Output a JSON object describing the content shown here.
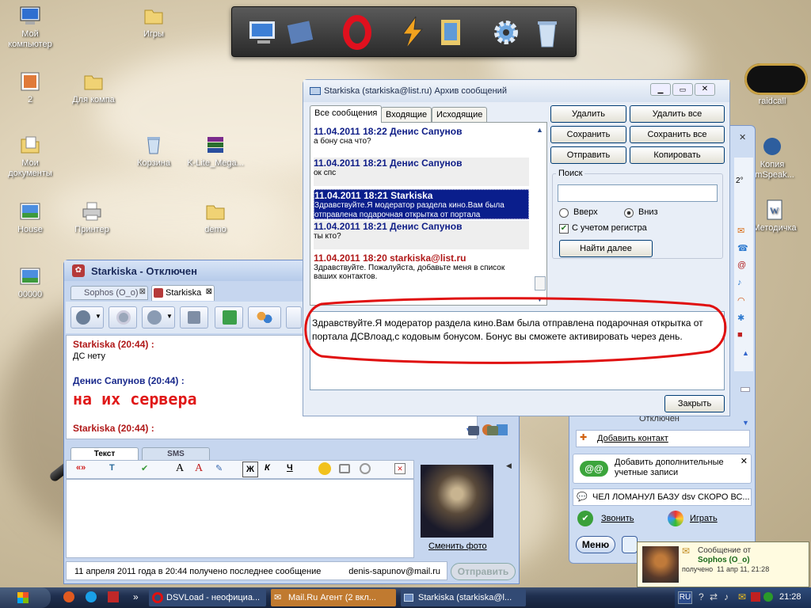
{
  "desktop": {
    "icons": [
      {
        "label": "Мой компьютер",
        "icon": "computer-icon"
      },
      {
        "label": "Игры",
        "icon": "folder-icon"
      },
      {
        "label": "2",
        "icon": "image-file-icon"
      },
      {
        "label": "Для компа",
        "icon": "folder-icon"
      },
      {
        "label": "Мои документы",
        "icon": "documents-folder-icon"
      },
      {
        "label": "Корзина",
        "icon": "recycle-bin-icon"
      },
      {
        "label": "K-Lite_Mega...",
        "icon": "archive-icon"
      },
      {
        "label": "House",
        "icon": "image-file-icon"
      },
      {
        "label": "Принтер",
        "icon": "printer-icon"
      },
      {
        "label": "demo",
        "icon": "folder-icon"
      },
      {
        "label": "00000",
        "icon": "image-file-icon"
      },
      {
        "label": "raidcall",
        "icon": "app-icon"
      },
      {
        "label": "Копия amSpeak...",
        "icon": "app-icon"
      },
      {
        "label": "Методичка",
        "icon": "word-document-icon"
      }
    ]
  },
  "chat": {
    "title": "Starkiska - Отключен",
    "tabs": [
      "Sophos (O_o)",
      "Starkiska"
    ],
    "messages": [
      {
        "header": "Starkiska (20:44) :",
        "text": "ДС нету"
      },
      {
        "header": "Денис Сапунов (20:44) :",
        "text": "на их сервера"
      },
      {
        "header": "Starkiska (20:44) :",
        "text": ""
      }
    ],
    "compose_tabs": [
      "Текст",
      "SMS"
    ],
    "change_photo": "Сменить фото",
    "status": "11 апреля 2011 года в 20:44 получено последнее сообщение",
    "email": "denis-sapunov@mail.ru",
    "send": "Отправить"
  },
  "archive": {
    "title": "Starkiska (starkiska@list.ru) Архив сообщений",
    "tabs": [
      "Все сообщения",
      "Входящие",
      "Исходящие"
    ],
    "messages": [
      {
        "header": "11.04.2011 18:22 Денис Сапунов",
        "text": "а бону сна что?"
      },
      {
        "header": "11.04.2011 18:21 Денис Сапунов",
        "text": "ок спс"
      },
      {
        "header": "11.04.2011 18:21 Starkiska",
        "text": "Здравствуйте.Я модератор раздела кино.Вам была отправлена подарочная открытка от портала"
      },
      {
        "header": "11.04.2011 18:21 Денис Сапунов",
        "text": "ты кто?"
      },
      {
        "header": "11.04.2011 18:20 starkiska@list.ru",
        "text": "Здравствуйте. Пожалуйста, добавьте меня в список ваших контактов."
      }
    ],
    "buttons": {
      "delete": "Удалить",
      "delete_all": "Удалить все",
      "save": "Сохранить",
      "save_all": "Сохранить все",
      "send": "Отправить",
      "copy": "Копировать"
    },
    "search": {
      "legend": "Поиск",
      "value": "",
      "up": "Вверх",
      "down": "Вниз",
      "case": "С учетом регистра",
      "find": "Найти далее"
    },
    "preview": "Здравствуйте.Я модератор раздела кино.Вам была отправлена подарочная открытка от портала ДСВлоад,с кодовым бонусом. Бонус вы сможете активировать через день.",
    "close": "Закрыть"
  },
  "agent": {
    "offline": "Отключен",
    "add_contact": "Добавить контакт",
    "add_accounts": "Добавить дополнительные учетные записи",
    "news": "ЧЕЛ ЛОМАНУЛ БАЗУ dsv СКОРО ВС...",
    "call": "Звонить",
    "play": "Играть",
    "menu": "Меню",
    "temp": "2°"
  },
  "notification": {
    "line1": "Сообщение от",
    "sender": "Sophos (O_o)",
    "received": "получено  11 апр 11, 21:28"
  },
  "taskbar": {
    "items": [
      "DSVLoad - неофициа...",
      "Mail.Ru Агент (2 вкл...",
      "Starkiska (starkiska@l..."
    ],
    "lang": "RU",
    "clock": "21:28",
    "more": "»"
  },
  "accent": {
    "selection": "#0a1e8c",
    "annotation": "#e01010",
    "taskbar": "#1f2f4f"
  }
}
